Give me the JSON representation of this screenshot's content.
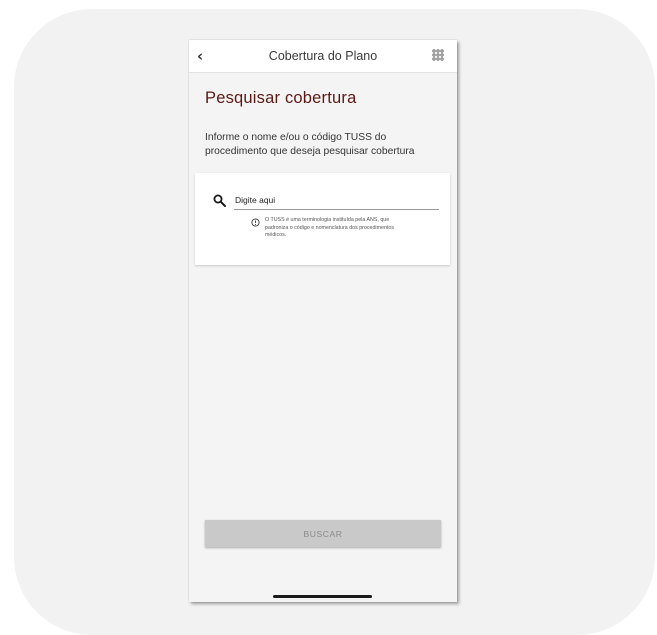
{
  "topbar": {
    "title": "Cobertura do Plano",
    "back_icon": "chevron-left-icon",
    "menu_icon": "grid-icon"
  },
  "main": {
    "page_title": "Pesquisar cobertura",
    "instructions": "Informe o nome e/ou o código TUSS do procedimento que deseja pesquisar cobertura"
  },
  "search": {
    "placeholder": "Digite aqui",
    "value": "",
    "info": "O TUSS é uma terminologia instituída pela ANS, que padroniza o código e nomenclatura dos procedimentos médicos."
  },
  "actions": {
    "search_button": "BUSCAR"
  },
  "colors": {
    "title": "#5a1a14",
    "button_bg": "#c9c9c9",
    "button_text": "#8a8a8a",
    "outer_card": "#f2f2f2"
  }
}
